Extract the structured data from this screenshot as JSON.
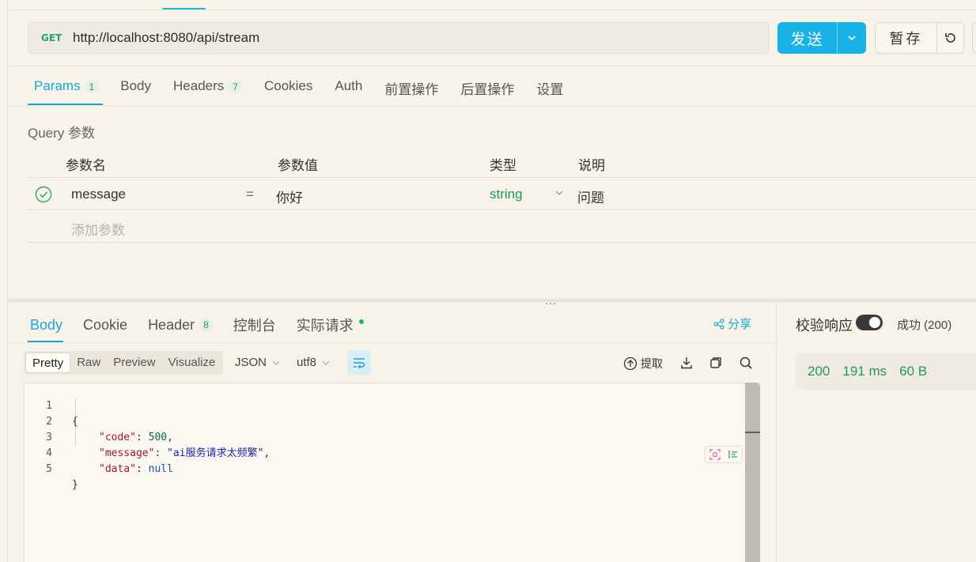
{
  "request": {
    "method": "GET",
    "url": "http://localhost:8080/api/stream",
    "send_label": "发送",
    "save_label": "暂存"
  },
  "req_tabs": [
    {
      "label": "Params",
      "badge": "1"
    },
    {
      "label": "Body"
    },
    {
      "label": "Headers",
      "badge": "7"
    },
    {
      "label": "Cookies"
    },
    {
      "label": "Auth"
    },
    {
      "label": "前置操作"
    },
    {
      "label": "后置操作"
    },
    {
      "label": "设置"
    }
  ],
  "query": {
    "title": "Query 参数",
    "headers": {
      "name": "参数名",
      "value": "参数值",
      "type": "类型",
      "desc": "说明"
    },
    "rows": [
      {
        "name": "message",
        "eq": "=",
        "value": "你好",
        "type": "string",
        "desc": "问题"
      }
    ],
    "add_placeholder": "添加参数"
  },
  "resp_tabs": [
    {
      "label": "Body"
    },
    {
      "label": "Cookie"
    },
    {
      "label": "Header",
      "badge": "8"
    },
    {
      "label": "控制台"
    },
    {
      "label": "实际请求"
    }
  ],
  "share_label": "分享",
  "view_tabs": [
    "Pretty",
    "Raw",
    "Preview",
    "Visualize"
  ],
  "format": "JSON",
  "encoding": "utf8",
  "extract_label": "提取",
  "code": {
    "line_numbers": [
      "1",
      "2",
      "3",
      "4",
      "5"
    ],
    "open_brace": "{",
    "close_brace": "}",
    "code_key": "\"code\"",
    "code_val": "500",
    "message_key": "\"message\"",
    "message_val": "\"ai服务请求太频繁\"",
    "data_key": "\"data\"",
    "data_val": "null"
  },
  "verify": {
    "label": "校验响应",
    "result": "成功 (200)"
  },
  "stats": {
    "status": "200",
    "time": "191 ms",
    "size": "60 B"
  }
}
